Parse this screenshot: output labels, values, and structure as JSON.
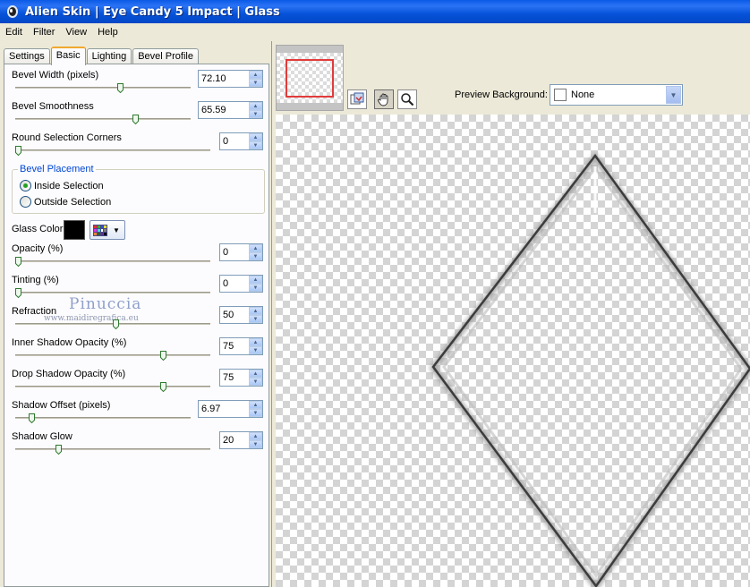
{
  "window": {
    "title": "Alien Skin | Eye Candy 5 Impact | Glass"
  },
  "menu": [
    "Edit",
    "Filter",
    "View",
    "Help"
  ],
  "tabs": [
    "Settings",
    "Basic",
    "Lighting",
    "Bevel Profile"
  ],
  "active_tab": "Basic",
  "controls": {
    "bevel_width": {
      "label": "Bevel Width (pixels)",
      "value": "72.10"
    },
    "bevel_smoothness": {
      "label": "Bevel Smoothness",
      "value": "65.59"
    },
    "round_corners": {
      "label": "Round Selection Corners",
      "value": "0"
    },
    "bevel_placement": {
      "legend": "Bevel Placement",
      "inside": "Inside Selection",
      "outside": "Outside Selection",
      "selected": "Inside Selection"
    },
    "glass_color": {
      "label": "Glass Color",
      "color": "#000000"
    },
    "opacity": {
      "label": "Opacity (%)",
      "value": "0"
    },
    "tinting": {
      "label": "Tinting (%)",
      "value": "0"
    },
    "refraction": {
      "label": "Refraction",
      "value": "50"
    },
    "inner_shadow_opacity": {
      "label": "Inner Shadow Opacity (%)",
      "value": "75"
    },
    "drop_shadow_opacity": {
      "label": "Drop Shadow Opacity (%)",
      "value": "75"
    },
    "shadow_offset": {
      "label": "Shadow Offset (pixels)",
      "value": "6.97"
    },
    "shadow_glow": {
      "label": "Shadow Glow",
      "value": "20"
    }
  },
  "watermark": {
    "name": "Pinuccia",
    "site": "www.maidiregrafica.eu"
  },
  "preview_background": {
    "label": "Preview Background:",
    "value": "None"
  },
  "icons": {
    "app": "alien-skin-icon",
    "tools": [
      "preview-toggle-icon",
      "hand-icon",
      "zoom-icon"
    ]
  }
}
